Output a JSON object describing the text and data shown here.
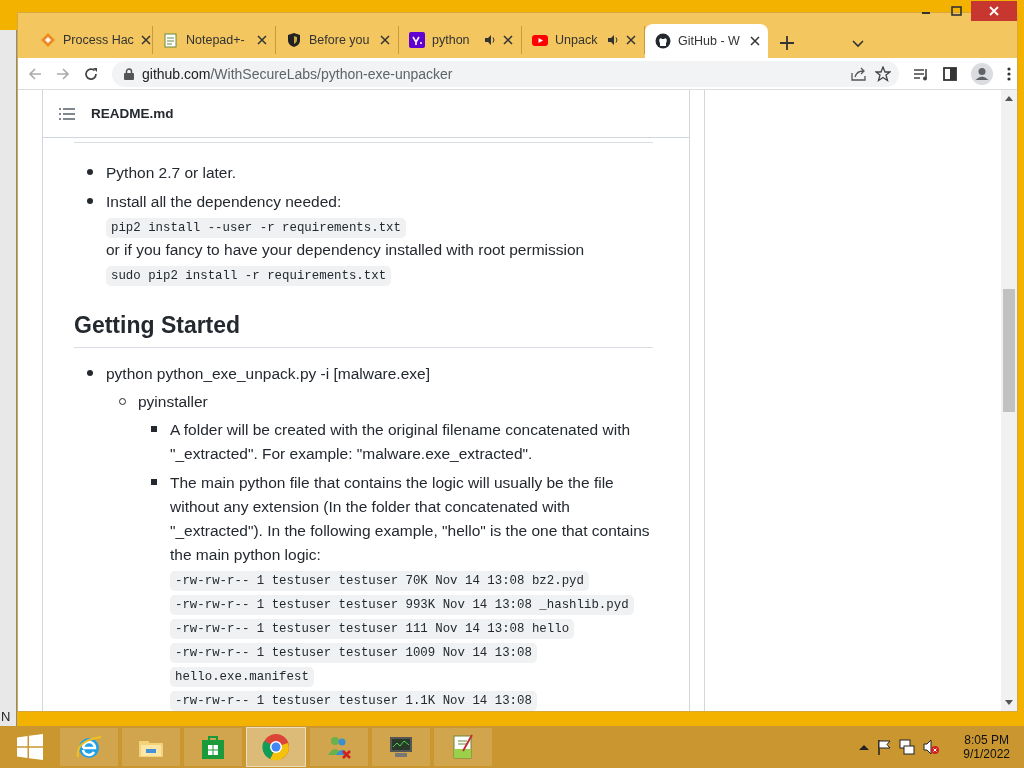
{
  "tabs": [
    {
      "title": "Process Hac",
      "audio": false,
      "selected": false
    },
    {
      "title": "Notepad+-",
      "audio": false,
      "selected": false
    },
    {
      "title": "Before you",
      "audio": false,
      "selected": false
    },
    {
      "title": "python",
      "audio": true,
      "selected": false
    },
    {
      "title": "Unpack",
      "audio": true,
      "selected": false
    },
    {
      "title": "GitHub - W",
      "audio": false,
      "selected": true
    }
  ],
  "address": {
    "host": "github.com",
    "path": "/WithSecureLabs/python-exe-unpacker"
  },
  "readme": {
    "title": "README.md"
  },
  "content": [
    {
      "kind": "list",
      "items": [
        {
          "text": "Python 2.7 or later."
        },
        {
          "text": "Install all the dependency needed:",
          "lines": [
            {
              "kind": "code",
              "text": "pip2 install --user -r requirements.txt"
            },
            {
              "kind": "text",
              "text": "or if you fancy to have your dependency installed with root permission"
            },
            {
              "kind": "code",
              "text": "sudo pip2 install -r requirements.txt"
            }
          ]
        }
      ]
    },
    {
      "kind": "heading",
      "text": "Getting Started"
    },
    {
      "kind": "list",
      "items": [
        {
          "text": "python python_exe_unpack.py -i [malware.exe]",
          "children": [
            {
              "text": "pyinstaller",
              "children": [
                {
                  "text": "A folder will be created with the original filename concatenated with \"_extracted\". For example: \"malware.exe_extracted\"."
                },
                {
                  "text": "The main python file that contains the logic will usually be the file without any extension (In the folder that concatenated with \"_extracted\"). In the following example, \"hello\" is the one that contains the main python logic:",
                  "lines": [
                    {
                      "kind": "code",
                      "text": "-rw-rw-r-- 1 testuser testuser 70K Nov 14 13:08 bz2.pyd"
                    },
                    {
                      "kind": "code",
                      "text": "-rw-rw-r-- 1 testuser testuser 993K Nov 14 13:08 _hashlib.pyd"
                    },
                    {
                      "kind": "code",
                      "text": "-rw-rw-r-- 1 testuser testuser 111 Nov 14 13:08 hello"
                    },
                    {
                      "kind": "code",
                      "text": "-rw-rw-r-- 1 testuser testuser 1009 Nov 14 13:08"
                    },
                    {
                      "kind": "code",
                      "text": "hello.exe.manifest"
                    },
                    {
                      "kind": "code",
                      "text": "-rw-rw-r-- 1 testuser testuser 1.1K Nov 14 13:08"
                    }
                  ]
                }
              ]
            }
          ]
        }
      ]
    }
  ],
  "desktop": {
    "partial_text": "N"
  },
  "taskbar": {
    "apps": [
      {
        "selected": false
      },
      {
        "selected": false
      },
      {
        "selected": false
      },
      {
        "selected": true
      },
      {
        "selected": false
      },
      {
        "selected": false
      },
      {
        "selected": false
      }
    ],
    "time": "8:05 PM",
    "date": "9/1/2022"
  }
}
